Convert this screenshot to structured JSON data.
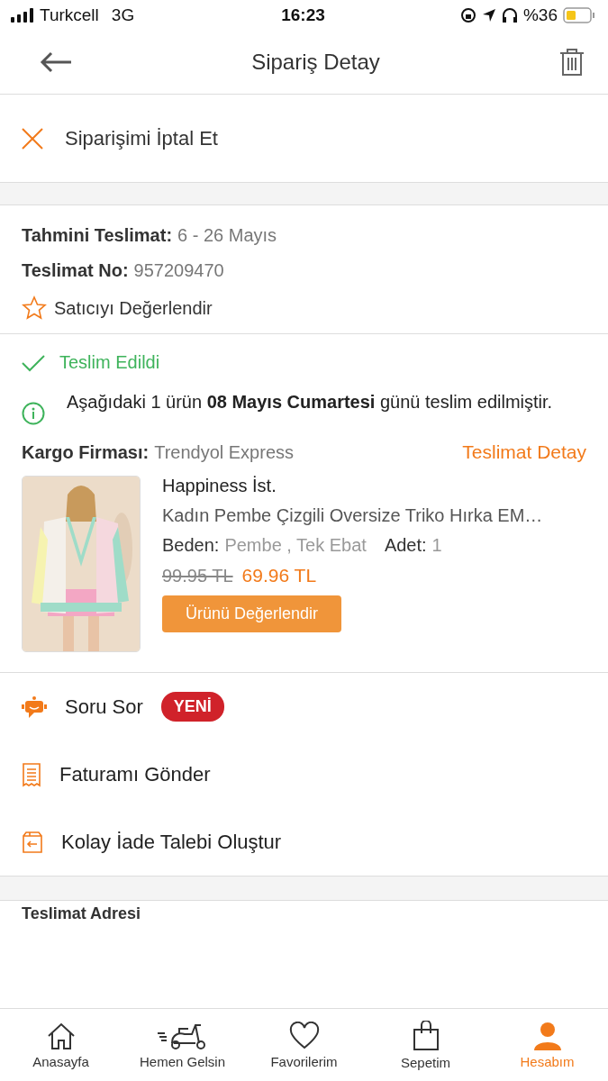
{
  "status_bar": {
    "carrier": "Turkcell",
    "network": "3G",
    "time": "16:23",
    "battery_text": "%36"
  },
  "header": {
    "title": "Sipariş Detay"
  },
  "cancel": {
    "label": "Siparişimi İptal Et"
  },
  "delivery_info": [
    {
      "label": "Tahmini Teslimat:",
      "value": "6 - 26 Mayıs"
    },
    {
      "label": "Teslimat No:",
      "value": "957209470"
    }
  ],
  "rate_seller": {
    "label": "Satıcıyı Değerlendir"
  },
  "delivery_status": {
    "label": "Teslim Edildi",
    "message": "Aşağıdaki 1 ürün **08 Mayıs Cumartesi** günü teslim edilmiştir."
  },
  "cargo": {
    "label": "Kargo Firması:",
    "value": "Trendyol Express",
    "link": "Teslimat Detay"
  },
  "product": {
    "brand": "Happiness İst.",
    "name": "Kadın Pembe Çizgili Oversize Triko Hırka EM…",
    "size_label": "Beden:",
    "size_value": "Pembe , Tek Ebat",
    "qty_label": "Adet:",
    "qty_value": "1",
    "old_price": "99.95 TL",
    "price": "69.96 TL",
    "button": "Ürünü Değerlendir"
  },
  "actions": [
    {
      "kind": "chat",
      "label": "Soru Sor",
      "badge": "YENİ"
    },
    {
      "kind": "invoice",
      "label": "Faturamı Gönder"
    },
    {
      "kind": "return",
      "label": "Kolay İade Talebi Oluştur"
    }
  ],
  "address": {
    "title": "Teslimat Adresi"
  },
  "tab_bar": [
    {
      "kind": "home",
      "label": "Anasayfa",
      "selected": false
    },
    {
      "kind": "scooter",
      "label": "Hemen Gelsin",
      "selected": false
    },
    {
      "kind": "heart",
      "label": "Favorilerim",
      "selected": false
    },
    {
      "kind": "bag",
      "label": "Sepetim",
      "selected": false
    },
    {
      "kind": "person",
      "label": "Hesabım",
      "selected": true
    }
  ]
}
